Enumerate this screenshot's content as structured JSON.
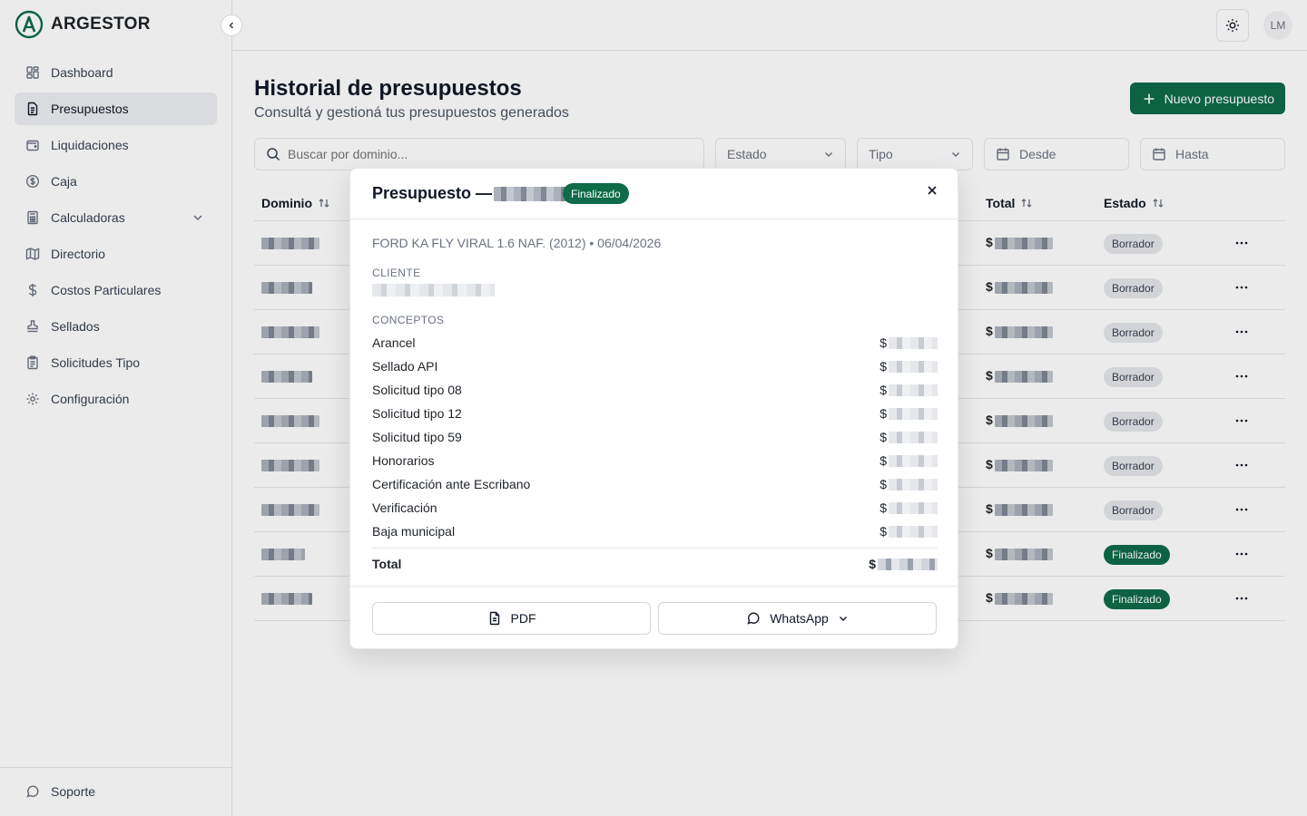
{
  "brand": {
    "name": "ARGESTOR"
  },
  "sidebar": {
    "items": [
      {
        "label": "Dashboard",
        "icon": "dashboard-icon"
      },
      {
        "label": "Presupuestos",
        "icon": "file-text-icon",
        "active": true
      },
      {
        "label": "Liquidaciones",
        "icon": "wallet-icon"
      },
      {
        "label": "Caja",
        "icon": "coin-icon"
      },
      {
        "label": "Calculadoras",
        "icon": "calculator-icon",
        "expandable": true
      },
      {
        "label": "Directorio",
        "icon": "map-icon"
      },
      {
        "label": "Costos Particulares",
        "icon": "dollar-icon"
      },
      {
        "label": "Sellados",
        "icon": "stamp-icon"
      },
      {
        "label": "Solicitudes Tipo",
        "icon": "clipboard-icon"
      },
      {
        "label": "Configuración",
        "icon": "gear-icon"
      }
    ],
    "footer": {
      "label": "Soporte",
      "icon": "chat-icon"
    }
  },
  "header": {
    "avatar": "LM",
    "theme_icon": "sun-icon"
  },
  "page": {
    "title": "Historial de presupuestos",
    "subtitle": "Consultá y gestioná tus presupuestos generados",
    "new_button": "Nuevo presupuesto"
  },
  "filters": {
    "search_placeholder": "Buscar por dominio...",
    "estado": "Estado",
    "tipo": "Tipo",
    "desde": "Desde",
    "hasta": "Hasta"
  },
  "table": {
    "columns": {
      "dominio": "Dominio",
      "total": "Total",
      "estado": "Estado"
    },
    "currency": "$",
    "rows": [
      {
        "estado": "Borrador",
        "status": "draft"
      },
      {
        "estado": "Borrador",
        "status": "draft"
      },
      {
        "estado": "Borrador",
        "status": "draft"
      },
      {
        "estado": "Borrador",
        "status": "draft"
      },
      {
        "estado": "Borrador",
        "status": "draft"
      },
      {
        "estado": "Borrador",
        "status": "draft"
      },
      {
        "estado": "Borrador",
        "status": "draft"
      },
      {
        "estado": "Finalizado",
        "status": "done"
      },
      {
        "estado": "Finalizado",
        "status": "done"
      }
    ]
  },
  "modal": {
    "title": "Presupuesto —",
    "badge": "Finalizado",
    "vehicle": "FORD KA FLY VIRAL 1.6 NAF. (2012) • 06/04/2026",
    "client_label": "CLIENTE",
    "concepts_label": "CONCEPTOS",
    "currency": "$",
    "concepts": [
      "Arancel",
      "Sellado API",
      "Solicitud tipo 08",
      "Solicitud tipo 12",
      "Solicitud tipo 59",
      "Honorarios",
      "Certificación ante Escribano",
      "Verificación",
      "Baja municipal"
    ],
    "total_label": "Total",
    "pdf_button": "PDF",
    "whatsapp_button": "WhatsApp"
  },
  "colors": {
    "accent": "#0f6b4a",
    "border": "#e5e7eb"
  }
}
